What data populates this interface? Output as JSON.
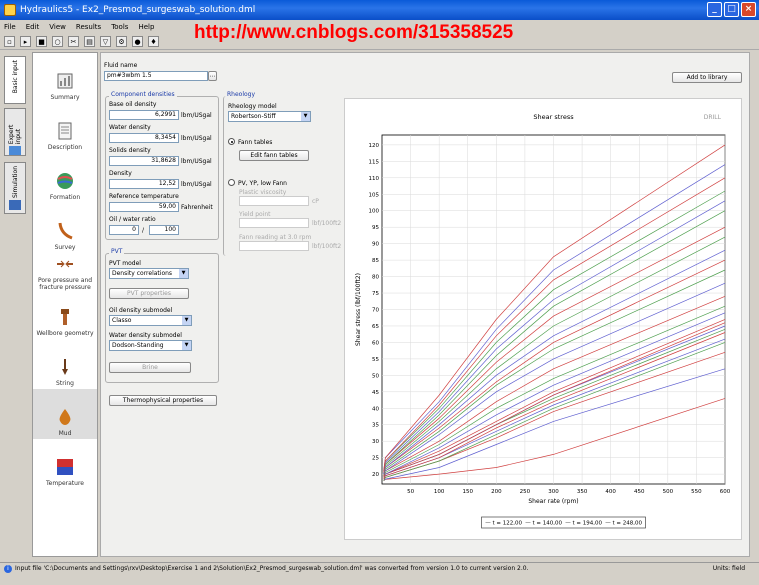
{
  "window": {
    "title": "Hydraulics5 - Ex2_Presmod_surgeswab_solution.dml"
  },
  "menu": [
    "File",
    "Edit",
    "View",
    "Results",
    "Tools",
    "Help"
  ],
  "watermark": "http://www.cnblogs.com/315358525",
  "tabs": [
    "Basic input",
    "Expert input",
    "Simulation"
  ],
  "nav": [
    {
      "label": "Summary",
      "icon": "summary-icon"
    },
    {
      "label": "Description",
      "icon": "description-icon"
    },
    {
      "label": "Formation",
      "icon": "formation-icon"
    },
    {
      "label": "Survey",
      "icon": "survey-icon"
    },
    {
      "label": "Pore pressure and fracture pressure",
      "icon": "pore-pressure-icon"
    },
    {
      "label": "Wellbore geometry",
      "icon": "wellbore-icon"
    },
    {
      "label": "String",
      "icon": "string-icon"
    },
    {
      "label": "Mud",
      "icon": "mud-icon"
    },
    {
      "label": "Temperature",
      "icon": "temperature-icon"
    }
  ],
  "fluid": {
    "name_label": "Fluid name",
    "name_value": "pm#3wbm 1.5",
    "add_library": "Add to library"
  },
  "component": {
    "title": "Component densities",
    "base_oil_label": "Base oil density",
    "base_oil_value": "6,2991",
    "base_oil_unit": "lbm/USgal",
    "water_label": "Water density",
    "water_value": "8,3454",
    "water_unit": "lbm/USgal",
    "solids_label": "Solids density",
    "solids_value": "31,8628",
    "solids_unit": "lbm/USgal",
    "density_label": "Density",
    "density_value": "12,52",
    "density_unit": "lbm/USgal",
    "ref_temp_label": "Reference temperature",
    "ref_temp_value": "59,00",
    "ref_temp_unit": "Fahrenheit",
    "ratio_label": "Oil / water ratio",
    "ratio_oil": "0",
    "ratio_sep": "/",
    "ratio_water": "100"
  },
  "pvt": {
    "title": "PVT",
    "model_label": "PVT model",
    "model_value": "Density correlations",
    "props_button": "PVT properties",
    "oil_label": "Oil density submodel",
    "oil_value": "Classo",
    "water_label": "Water density submodel",
    "water_value": "Dodson-Standing",
    "brine_button": "Brine"
  },
  "thermo_button": "Thermophysical properties",
  "rheology": {
    "title": "Rheology",
    "model_label": "Rheology model",
    "model_value": "Robertson-Stiff",
    "fann_label": "Fann tables",
    "edit_button": "Edit fann tables",
    "pv_label": "PV, YP, low Fann",
    "plastic_label": "Plastic viscosity",
    "plastic_unit": "cP",
    "yield_label": "Yield point",
    "yield_unit": "lbf/100ft2",
    "fannread_label": "Fann reading at 3.0 rpm",
    "fannread_unit": "lbf/100ft2"
  },
  "status": {
    "message": "Input file 'C:\\Documents and Settings\\rxv\\Desktop\\Exercise 1 and 2\\Solution\\Ex2_Presmod_surgeswab_solution.dml' was converted from version 1.0 to current version 2.0.",
    "units": "Units: field"
  },
  "chart_data": {
    "type": "line",
    "title": "Shear stress",
    "brand": "DRILL",
    "xlabel": "Shear rate (rpm)",
    "ylabel": "Shear stress (lbf/100ft2)",
    "xlim": [
      0,
      600
    ],
    "ylim": [
      17,
      123
    ],
    "xticks": [
      50,
      100,
      150,
      200,
      250,
      300,
      350,
      400,
      450,
      500,
      550,
      600
    ],
    "yticks": [
      20,
      25,
      30,
      35,
      40,
      45,
      50,
      55,
      60,
      65,
      70,
      75,
      80,
      85,
      90,
      95,
      100,
      105,
      110,
      115,
      120
    ],
    "grid": true,
    "legend_position": "bottom",
    "legend": [
      "t = 122,00",
      "t = 140,00",
      "t = 194,00",
      "t = 248,00"
    ],
    "x": [
      3,
      6,
      100,
      200,
      300,
      600
    ],
    "series": [
      {
        "color": "#d04040",
        "values": [
          18,
          18.4,
          20,
          22,
          26,
          43
        ]
      },
      {
        "color": "#6060d0",
        "values": [
          18,
          18.5,
          22,
          29,
          36,
          52
        ]
      },
      {
        "color": "#d04040",
        "values": [
          18,
          19,
          24,
          31,
          39,
          57
        ]
      },
      {
        "color": "#50a050",
        "values": [
          18,
          19,
          24,
          32,
          40,
          60
        ]
      },
      {
        "color": "#6060d0",
        "values": [
          18.5,
          19.5,
          25,
          33,
          41,
          61
        ]
      },
      {
        "color": "#d04040",
        "values": [
          18.5,
          19.5,
          25,
          34,
          42,
          63
        ]
      },
      {
        "color": "#50a050",
        "values": [
          19,
          20,
          26,
          35,
          43,
          64
        ]
      },
      {
        "color": "#6060d0",
        "values": [
          19,
          20,
          26,
          35,
          44,
          65
        ]
      },
      {
        "color": "#d04040",
        "values": [
          19,
          20,
          26,
          35,
          44,
          66
        ]
      },
      {
        "color": "#d04040",
        "values": [
          19,
          20,
          27,
          36,
          45,
          67
        ]
      },
      {
        "color": "#6060d0",
        "values": [
          19,
          20,
          28,
          38,
          47,
          69
        ]
      },
      {
        "color": "#50a050",
        "values": [
          19,
          20.5,
          29,
          40,
          49,
          71
        ]
      },
      {
        "color": "#d04040",
        "values": [
          19,
          21,
          30,
          42,
          52,
          74
        ]
      },
      {
        "color": "#6060d0",
        "values": [
          19.5,
          21,
          32,
          45,
          55,
          78
        ]
      },
      {
        "color": "#50a050",
        "values": [
          19.5,
          21.5,
          33,
          47,
          58,
          82
        ]
      },
      {
        "color": "#d04040",
        "values": [
          19.5,
          22,
          34,
          48,
          60,
          85
        ]
      },
      {
        "color": "#6060d0",
        "values": [
          20,
          22,
          35,
          50,
          62,
          88
        ]
      },
      {
        "color": "#50a050",
        "values": [
          20,
          22.5,
          36,
          52,
          65,
          92
        ]
      },
      {
        "color": "#d04040",
        "values": [
          20,
          23,
          37,
          54,
          68,
          95
        ]
      },
      {
        "color": "#50a050",
        "values": [
          20,
          23,
          38,
          56,
          71,
          100
        ]
      },
      {
        "color": "#6060d0",
        "values": [
          20,
          23.5,
          39,
          58,
          73,
          103
        ]
      },
      {
        "color": "#50a050",
        "values": [
          20.5,
          24,
          40,
          60,
          76,
          106
        ]
      },
      {
        "color": "#d04040",
        "values": [
          20.5,
          24,
          41,
          62,
          79,
          110
        ]
      },
      {
        "color": "#6060d0",
        "values": [
          21,
          25,
          42,
          64,
          82,
          114
        ]
      },
      {
        "color": "#d04040",
        "values": [
          21,
          25,
          44,
          67,
          86,
          120
        ]
      }
    ]
  }
}
